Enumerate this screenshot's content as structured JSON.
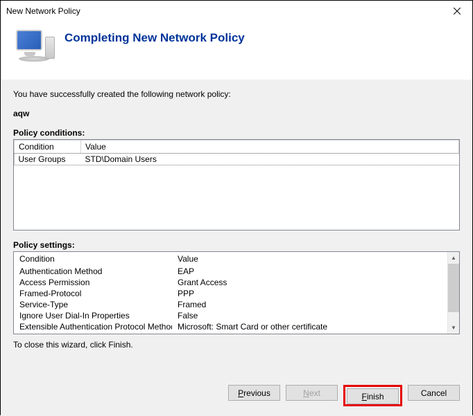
{
  "window": {
    "title": "New Network Policy"
  },
  "heading": "Completing New Network Policy",
  "intro": "You have successfully created the following network policy:",
  "policyName": "aqw",
  "conditions": {
    "label": "Policy conditions:",
    "headers": {
      "condition": "Condition",
      "value": "Value"
    },
    "rows": [
      {
        "condition": "User Groups",
        "value": "STD\\Domain Users"
      }
    ]
  },
  "settings": {
    "label": "Policy settings:",
    "headers": {
      "condition": "Condition",
      "value": "Value"
    },
    "rows": [
      {
        "condition": "Authentication Method",
        "value": "EAP"
      },
      {
        "condition": "Access Permission",
        "value": "Grant Access"
      },
      {
        "condition": "Framed-Protocol",
        "value": "PPP"
      },
      {
        "condition": "Service-Type",
        "value": "Framed"
      },
      {
        "condition": "Ignore User Dial-In Properties",
        "value": "False"
      },
      {
        "condition": "Extensible Authentication Protocol Method",
        "value": "Microsoft: Smart Card or other certificate"
      }
    ]
  },
  "closing": "To close this wizard, click Finish.",
  "buttons": {
    "previous": "Previous",
    "next": "Next",
    "finish": "Finish",
    "cancel": "Cancel"
  }
}
